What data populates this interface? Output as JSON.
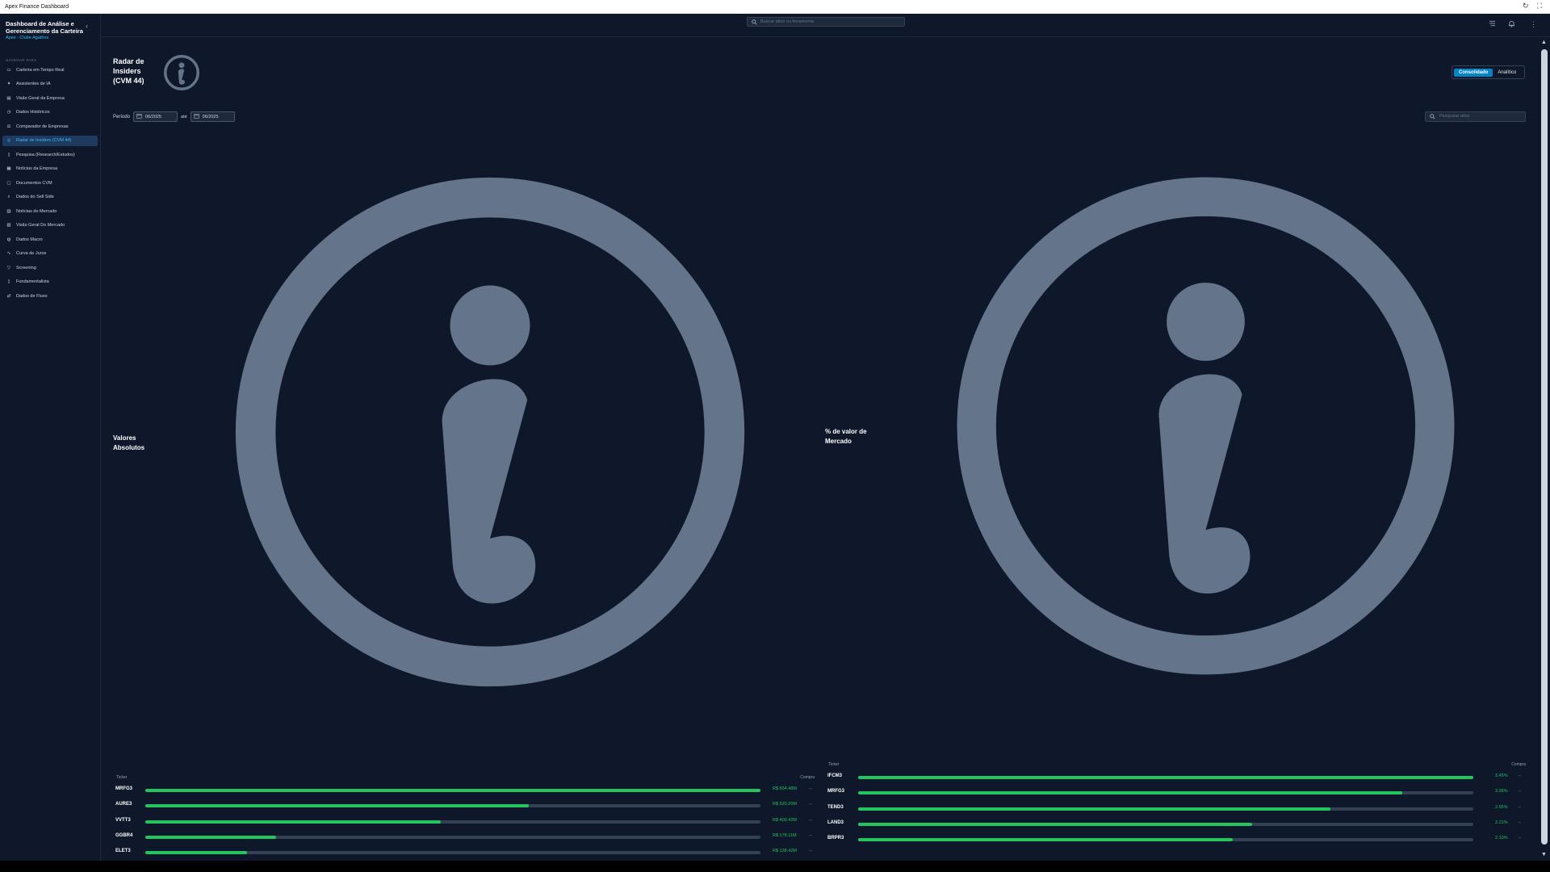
{
  "window": {
    "title": "Apex Finance Dashboard"
  },
  "sidebar": {
    "title": "Dashboard de Análise e Gerenciamento da Carteira",
    "subtitle": "Apex - Clube Agathos",
    "section": "NAVEGAR PARA",
    "items": [
      {
        "label": "Carteira em Tempo Real",
        "icon": "wallet-icon"
      },
      {
        "label": "Assistentes de IA",
        "icon": "sparkle-icon"
      },
      {
        "label": "Visão Geral da Empresa",
        "icon": "building-icon"
      },
      {
        "label": "Dados Históricos",
        "icon": "clock-icon"
      },
      {
        "label": "Comparador de Empresas",
        "icon": "scale-icon"
      },
      {
        "label": "Radar de Insiders (CVM 44)",
        "icon": "radar-icon",
        "active": true
      },
      {
        "label": "Pesquisa (Research/Estudos)",
        "icon": "file-icon"
      },
      {
        "label": "Notícias da Empresa",
        "icon": "newspaper-icon"
      },
      {
        "label": "Documentos CVM",
        "icon": "document-icon"
      },
      {
        "label": "Dados do Sell Side",
        "icon": "search-icon"
      },
      {
        "label": "Notícias do Mercado",
        "icon": "news-icon"
      },
      {
        "label": "Visão Geral Do Mercado",
        "icon": "chart-icon"
      },
      {
        "label": "Dados Macro",
        "icon": "globe-icon"
      },
      {
        "label": "Curva de Juros",
        "icon": "curve-icon"
      },
      {
        "label": "Screening",
        "icon": "filter-icon"
      },
      {
        "label": "Fundamentalista",
        "icon": "book-icon"
      },
      {
        "label": "Dados de Fluxo",
        "icon": "flow-icon"
      }
    ]
  },
  "header": {
    "search_placeholder": "Buscar ativo ou ferramenta"
  },
  "page": {
    "title": "Radar de Insiders (CVM 44)",
    "toggle": {
      "consolidated": "Consolidado",
      "analytic": "Analítico"
    },
    "period": {
      "label": "Período",
      "from": "06/2025",
      "sep": "até",
      "to": "06/2025"
    },
    "asset_search_placeholder": "Pesquisar ativo"
  },
  "panels": {
    "absolute": {
      "label": "Valores Absolutos",
      "col_ticker": "Ticker",
      "col_value": "Compra",
      "rows": [
        {
          "ticker": "MRFG3",
          "value": "R$ 834.48M",
          "pct": 100
        },
        {
          "ticker": "AURE3",
          "value": "R$ 520.20M",
          "pct": 62.3
        },
        {
          "ticker": "VVTT3",
          "value": "R$ 400.42M",
          "pct": 48
        },
        {
          "ticker": "GGBR4",
          "value": "R$ 178.11M",
          "pct": 21.3
        },
        {
          "ticker": "ELET3",
          "value": "R$ 138.42M",
          "pct": 16.6
        }
      ]
    },
    "percent": {
      "label": "% de valor de Mercado",
      "col_ticker": "Ticker",
      "col_value": "Compra",
      "rows": [
        {
          "ticker": "IFCM3",
          "value": "3.45%",
          "pct": 100
        },
        {
          "ticker": "MRFG3",
          "value": "3.05%",
          "pct": 88.4
        },
        {
          "ticker": "TEND3",
          "value": "2.65%",
          "pct": 76.8
        },
        {
          "ticker": "LAND3",
          "value": "2.21%",
          "pct": 64
        },
        {
          "ticker": "BRPR3",
          "value": "2.10%",
          "pct": 60.9
        }
      ]
    }
  },
  "colors": {
    "background": "#0f172a",
    "accent": "#38bdf8",
    "bar": "#22c55e",
    "icon": "#64748b"
  }
}
